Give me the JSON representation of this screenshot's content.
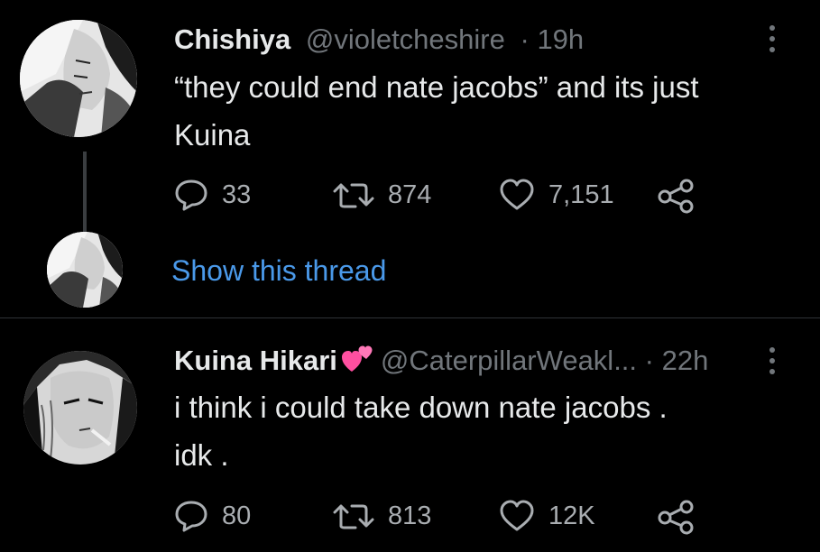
{
  "thread": {
    "tweet1": {
      "display_name": "Chishiya",
      "handle": "@violetcheshire",
      "separator": "·",
      "time": "19h",
      "text_line1": "“they could end nate jacobs” and its just",
      "text_line2": " Kuina",
      "replies": "33",
      "retweets": "874",
      "likes": "7,151",
      "show_thread_label": "Show this thread"
    },
    "tweet2": {
      "display_name": "Kuina Hikari",
      "emoji": "pink-hearts-emoji",
      "handle": "@CaterpillarWeakl...",
      "separator": "·",
      "time": "22h",
      "text_line1": "i think i could take down nate jacobs .",
      "text_line2": "idk .",
      "replies": "80",
      "retweets": "813",
      "likes": "12K"
    }
  },
  "icons": {
    "reply": "reply-icon",
    "retweet": "retweet-icon",
    "like": "heart-icon",
    "share": "share-icon",
    "more": "more-icon"
  },
  "colors": {
    "background": "#000000",
    "text_primary": "#e7e9ea",
    "text_secondary": "#71767b",
    "link": "#4a99e9",
    "divider": "#2f3336",
    "heart_pink": "#ff4fa0"
  }
}
